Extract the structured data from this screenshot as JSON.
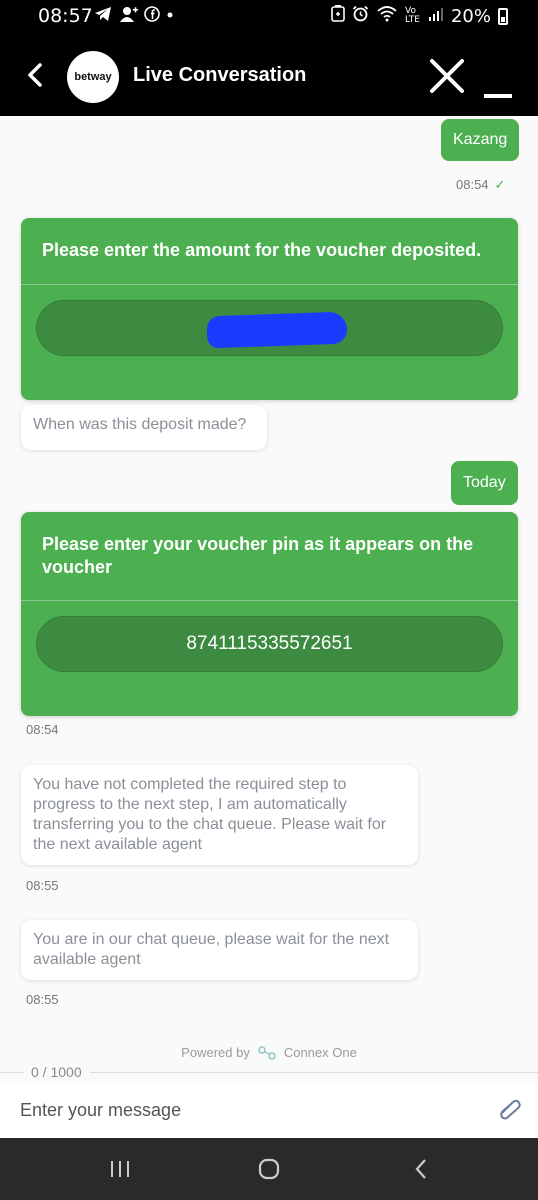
{
  "status_bar": {
    "time": "08:57",
    "left_icons": [
      "telegram-icon",
      "add-contact-icon",
      "facebook-icon",
      "dot-icon"
    ],
    "right_icons": [
      "battery-saver-icon",
      "alarm-icon",
      "wifi-icon",
      "volte-icon",
      "signal-icon"
    ],
    "volte_label": "Vo LTE",
    "battery": "20%"
  },
  "header": {
    "logo_text": "betway",
    "title": "Live Conversation"
  },
  "messages": {
    "m1": {
      "text": "Kazang",
      "time": "08:54",
      "check": "✓"
    },
    "card1": {
      "title": "Please enter the amount for the voucher deposited.",
      "option": ""
    },
    "m2": {
      "text": "When was this deposit made?"
    },
    "m3": {
      "text": "Today"
    },
    "card2": {
      "title": "Please enter your voucher pin as it appears on the voucher",
      "option": "8741115335572651",
      "time": "08:54"
    },
    "m4": {
      "text": "You have not completed the required step to progress to the next step, I am automatically transferring you to the chat queue. Please wait for the next available agent",
      "time": "08:55"
    },
    "m5": {
      "text": "You are in our chat queue, please wait for the next available agent",
      "time": "08:55"
    }
  },
  "footer": {
    "powered_by": "Powered by",
    "brand": "Connex One",
    "counter": "0 / 1000",
    "placeholder": "Enter your message"
  },
  "colors": {
    "accent": "#4caf50",
    "option_bg": "#3d8b40",
    "header_bg": "#000000",
    "redaction": "#1a3cff"
  }
}
